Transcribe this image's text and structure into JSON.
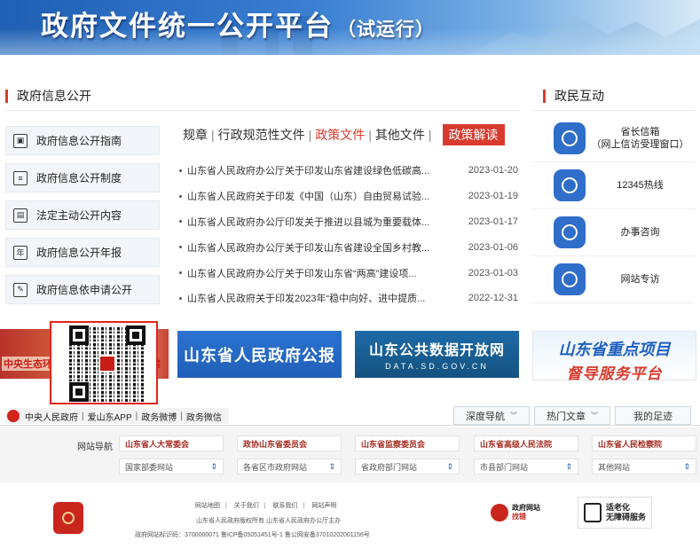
{
  "header": {
    "title": "政府文件统一公开平台",
    "subtitle": "（试运行）"
  },
  "left_section": {
    "title": "政府信息公开",
    "menu": [
      {
        "label": "政府信息公开指南",
        "icon": "book-icon"
      },
      {
        "label": "政府信息公开制度",
        "icon": "document-list-icon"
      },
      {
        "label": "法定主动公开内容",
        "icon": "file-icon"
      },
      {
        "label": "政府信息公开年报",
        "icon": "year-report-icon"
      },
      {
        "label": "政府信息依申请公开",
        "icon": "apply-form-icon"
      }
    ]
  },
  "middle": {
    "tabs": [
      "规章",
      "行政规范性文件",
      "政策文件",
      "其他文件"
    ],
    "active_tab": "政策文件",
    "interpret_label": "政策解读",
    "news": [
      {
        "title": "山东省人民政府办公厅关于印发山东省建设绿色低碳高...",
        "date": "2023-01-20"
      },
      {
        "title": "山东省人民政府关于印发《中国（山东）自由贸易试验...",
        "date": "2023-01-19"
      },
      {
        "title": "山东省人民政府办公厅印发关于推进以县城为重要载体...",
        "date": "2023-01-17"
      },
      {
        "title": "山东省人民政府办公厅关于印发山东省建设全国乡村教...",
        "date": "2023-01-06"
      },
      {
        "title": "山东省人民政府办公厅关于印发山东省“两高”建设项...",
        "date": "2023-01-03"
      },
      {
        "title": "山东省人民政府关于印发2023年“稳中向好、进中提质...",
        "date": "2022-12-31"
      }
    ]
  },
  "right_section": {
    "title": "政民互动",
    "items": [
      {
        "label": "省长信箱",
        "label2": "（网上信访受理窗口）",
        "icon": "mailbox-icon"
      },
      {
        "label": "12345热线",
        "label2": "",
        "icon": "hotline-icon"
      },
      {
        "label": "办事咨询",
        "label2": "",
        "icon": "chat-icon"
      },
      {
        "label": "网站专访",
        "label2": "",
        "icon": "interview-icon"
      }
    ]
  },
  "banners": {
    "left_slogan": "中央生态环",
    "left_slogan_tail": "察",
    "gazette": "山东省人民政府公报",
    "opendata_title": "山东公共数据开放网",
    "opendata_url": "DATA.SD.GOV.CN",
    "keyproj_line1": "山东省重点项目",
    "keyproj_line2": "督导服务平台"
  },
  "quickbar": {
    "links": [
      "中央人民政府",
      "爱山东APP",
      "政务微博",
      "政务微信"
    ],
    "buttons": [
      "深度导航",
      "热门文章",
      "我的足迹"
    ]
  },
  "sitenav": {
    "label": "网站导航",
    "links": [
      "山东省人大常委会",
      "政协山东省委员会",
      "山东省监察委员会",
      "山东省高级人民法院",
      "山东省人民检察院"
    ],
    "selects": [
      "国家部委网站",
      "各省区市政府网站",
      "省政府部门网站",
      "市县部门网站",
      "其他网站"
    ]
  },
  "footer": {
    "links": [
      "网站地图",
      "关于我们",
      "联系我们",
      "网站声明"
    ],
    "copyright": "山东省人民政府版权所有 山东省人民政府办公厅主办",
    "site_id": "政府网站标识码：3700000071 鲁ICP备05051451号-1   鲁公网安备37010202001156号",
    "correction_line1": "政府网站",
    "correction_line2": "找错",
    "aging_line1": "适老化",
    "aging_line2": "无障碍服务",
    "emblem_text": "党政机关"
  },
  "colors": {
    "accent_red": "#d83a2e",
    "brand_blue": "#2f6ec9"
  }
}
